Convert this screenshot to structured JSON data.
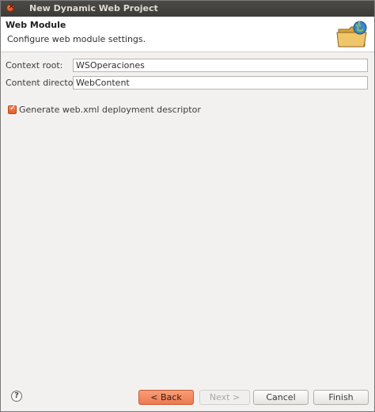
{
  "window": {
    "title": "New Dynamic Web Project"
  },
  "header": {
    "title": "Web Module",
    "description": "Configure web module settings.",
    "icon": "folder-globe-icon"
  },
  "form": {
    "context_root": {
      "label": "Context root:",
      "value": "WSOperaciones"
    },
    "content_directory": {
      "label": "Content directory:",
      "value": "WebContent"
    },
    "generate_descriptor": {
      "label": "Generate web.xml deployment descriptor",
      "checked": true
    }
  },
  "footer": {
    "help_glyph": "?",
    "back_label": "< Back",
    "next_label": "Next >",
    "cancel_label": "Cancel",
    "finish_label": "Finish",
    "next_enabled": false
  },
  "colors": {
    "accent": "#ee7a4f",
    "titlebar": "#3c3b37",
    "dialog_bg": "#f2f1f0"
  }
}
